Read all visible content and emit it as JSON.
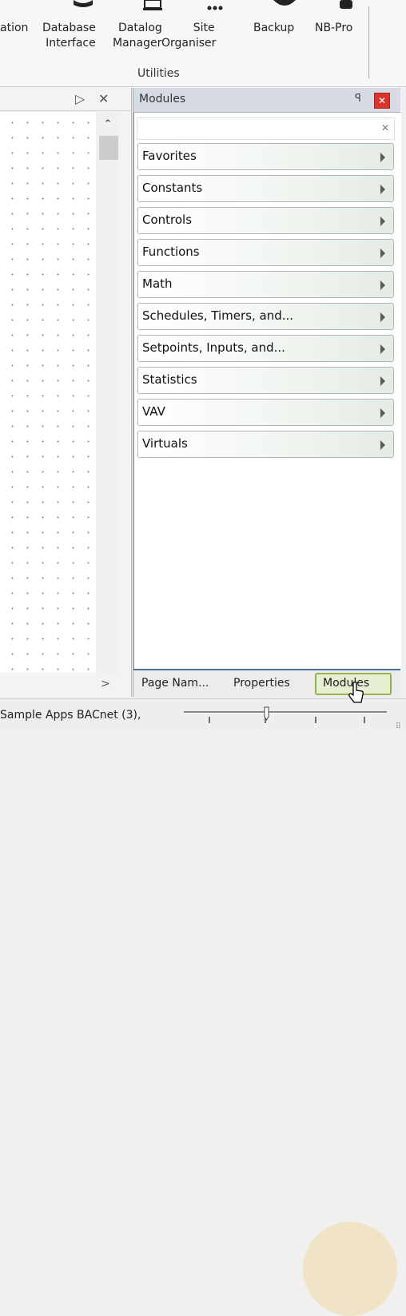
{
  "ribbon": {
    "buttons": [
      {
        "label_lines": [
          "ation"
        ],
        "icon": "documentation-icon"
      },
      {
        "label_lines": [
          "Database",
          "Interface"
        ],
        "icon": "database-interface-icon"
      },
      {
        "label_lines": [
          "Datalog",
          "Manager"
        ],
        "icon": "datalog-manager-icon"
      },
      {
        "label_lines": [
          "Site",
          "Organiser"
        ],
        "icon": "site-organiser-icon"
      },
      {
        "label_lines": [
          "Backup"
        ],
        "icon": "backup-icon"
      },
      {
        "label_lines": [
          "NB-Pro"
        ],
        "icon": "nb-pro-icon"
      }
    ],
    "group_label": "Utilities"
  },
  "left_pane": {
    "dock_icon": "dock-arrow-icon",
    "close_icon": "close-icon",
    "scroll_up_icon": "scroll-up-icon",
    "scroll_down_icon": "scroll-down-icon",
    "scroll_right_icon": "scroll-right-icon"
  },
  "modules_panel": {
    "title": "Modules",
    "pin_icon": "pin-icon",
    "close_icon": "close-icon",
    "search": {
      "value": "",
      "placeholder": "",
      "clear_icon": "clear-icon"
    },
    "categories": [
      "Favorites",
      "Constants",
      "Controls",
      "Functions",
      "Math",
      "Schedules, Timers, and...",
      "Setpoints, Inputs, and...",
      "Statistics",
      "VAV",
      "Virtuals"
    ]
  },
  "tabs": {
    "items": [
      "Page Nam...",
      "Properties",
      "Modules"
    ],
    "active": "Modules"
  },
  "status_bar": {
    "text": "Sample Apps BACnet (3),",
    "zoom_slider_icon": "zoom-slider-icon",
    "grip_icon": "resize-grip-icon"
  },
  "colors": {
    "close_button": "#d9352c",
    "active_tab_border": "#93b24c",
    "tab_strip_border": "#4e6b9a"
  }
}
